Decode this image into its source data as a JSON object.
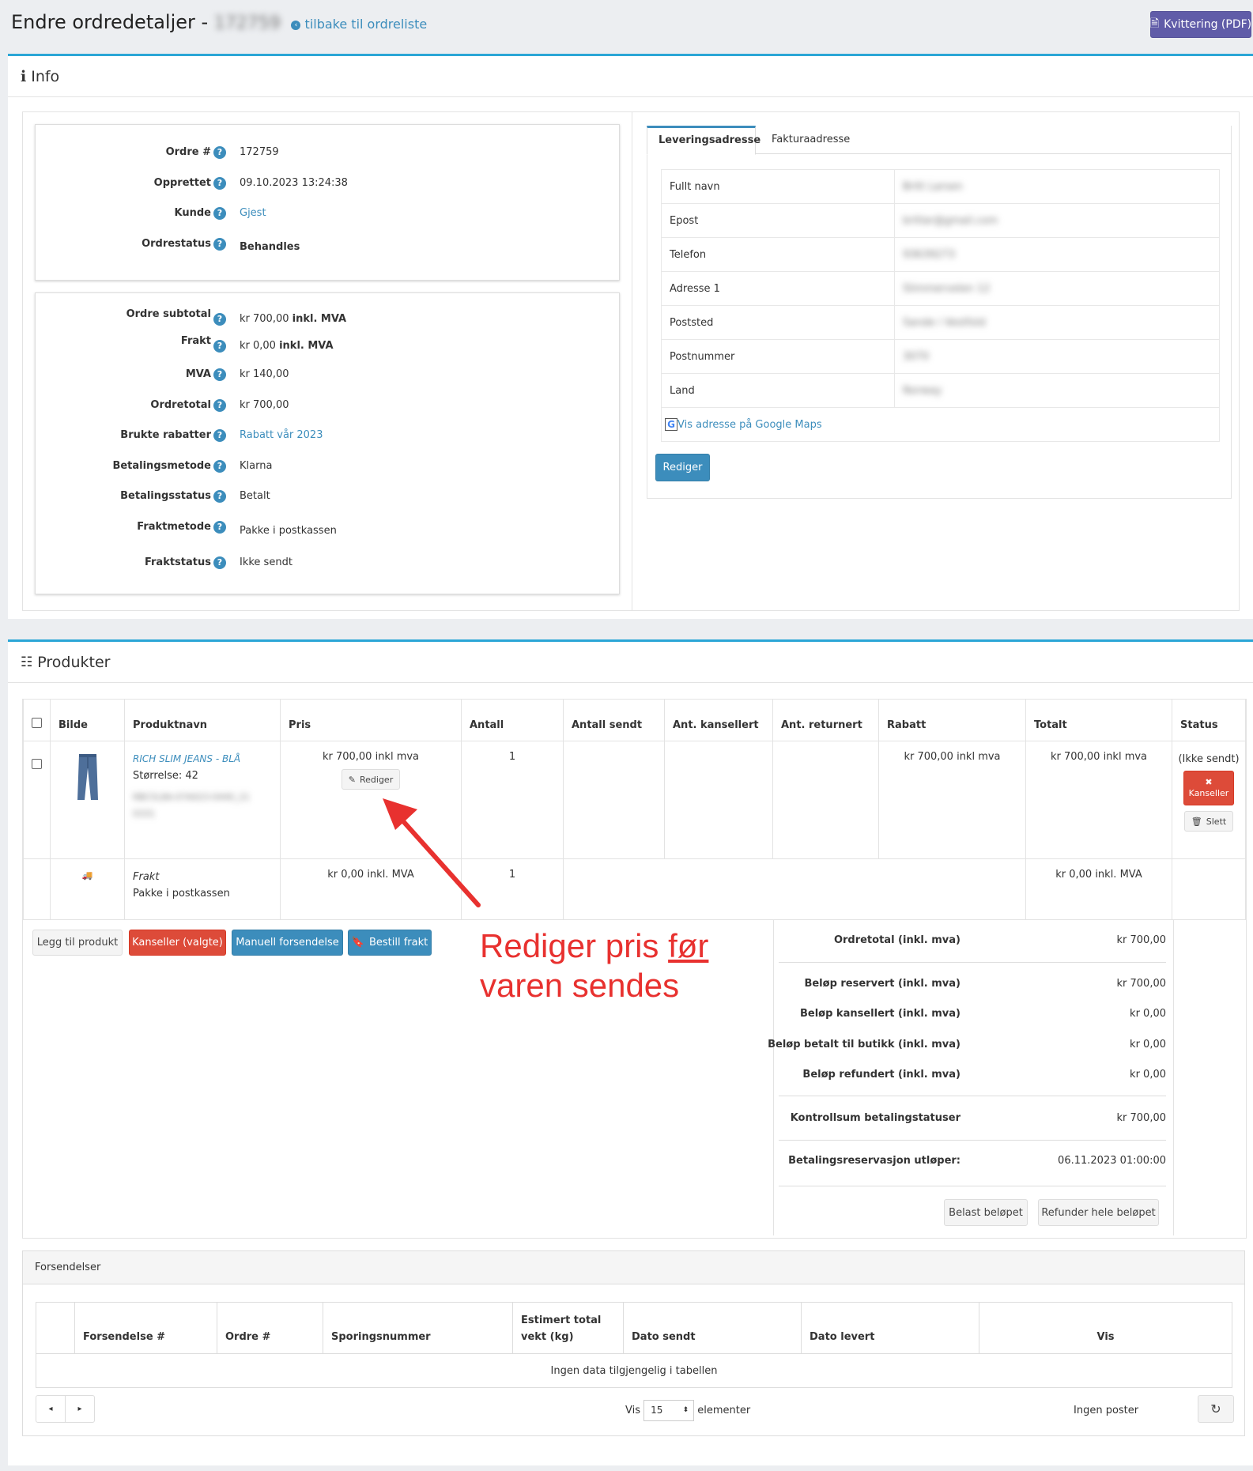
{
  "header": {
    "title": "Endre ordredetaljer -",
    "order_id_blurred": "172759",
    "back_link": "tilbake til ordreliste",
    "receipt_button": "Kvittering (PDF)"
  },
  "info": {
    "section_title": "Info",
    "order_card": [
      {
        "label": "Ordre #",
        "value": "172759"
      },
      {
        "label": "Opprettet",
        "value": "09.10.2023 13:24:38"
      },
      {
        "label": "Kunde",
        "value": "Gjest"
      },
      {
        "label": "Ordrestatus",
        "value": "Behandles"
      }
    ],
    "totals_card": [
      {
        "label": "Ordre subtotal",
        "value": "kr 700,00",
        "suffix": "inkl. MVA"
      },
      {
        "label": "Frakt",
        "value": "kr 0,00",
        "suffix": "inkl. MVA"
      },
      {
        "label": "MVA",
        "value": "kr 140,00"
      },
      {
        "label": "Ordretotal",
        "value": "kr 700,00"
      },
      {
        "label": "Brukte rabatter",
        "value": "Rabatt vår 2023"
      },
      {
        "label": "Betalingsmetode",
        "value": "Klarna"
      },
      {
        "label": "Betalingsstatus",
        "value": "Betalt"
      },
      {
        "label": "Fraktmetode",
        "value": "Pakke i postkassen"
      },
      {
        "label": "Fraktstatus",
        "value": "Ikke sendt"
      }
    ],
    "tabs": [
      "Leveringsadresse",
      "Fakturaadresse"
    ],
    "address_rows": [
      {
        "label": "Fullt navn",
        "value": "Britt Larsen"
      },
      {
        "label": "Epost",
        "value": "britlar@gmail.com"
      },
      {
        "label": "Telefon",
        "value": "93639273"
      },
      {
        "label": "Adresse 1",
        "value": "Slimmervelen 12"
      },
      {
        "label": "Poststed",
        "value": "Sande i Vestfold"
      },
      {
        "label": "Postnummer",
        "value": "3070"
      },
      {
        "label": "Land",
        "value": "Norway"
      }
    ],
    "maps_link": "Vis adresse på Google Maps",
    "edit_button": "Rediger"
  },
  "products": {
    "section_title": "Produkter",
    "columns": [
      "Bilde",
      "Produktnavn",
      "Pris",
      "Antall",
      "Antall sendt",
      "Ant. kansellert",
      "Ant. returnert",
      "Rabatt",
      "Totalt",
      "Status"
    ],
    "item": {
      "name": "RICH SLIM JEANS - BLÅ",
      "size": "Størrelse: 42",
      "sku": "RBC5L8A-07A023-0440_21 0331",
      "price": "kr 700,00 inkl mva",
      "edit_label": "Rediger",
      "qty": "1",
      "discount": "kr 700,00 inkl mva",
      "total": "kr 700,00 inkl mva",
      "status": "(Ikke sendt)",
      "cancel_label": "Kanseller",
      "delete_label": "Slett"
    },
    "shipping": {
      "name": "Frakt",
      "method": "Pakke i postkassen",
      "price": "kr 0,00 inkl. MVA",
      "qty": "1",
      "total": "kr 0,00 inkl. MVA"
    },
    "actions": {
      "add": "Legg til produkt",
      "cancel_selected": "Kanseller (valgte)",
      "manual_ship": "Manuell forsendelse",
      "order_ship": "Bestill frakt"
    },
    "summary": {
      "order_total_label": "Ordretotal (inkl. mva)",
      "order_total": "kr 700,00",
      "reserved_label": "Beløp reservert (inkl. mva)",
      "reserved": "kr 700,00",
      "cancelled_label": "Beløp kansellert (inkl. mva)",
      "cancelled": "kr 0,00",
      "paid_label": "Beløp betalt til butikk (inkl. mva)",
      "paid": "kr 0,00",
      "refunded_label": "Beløp refundert (inkl. mva)",
      "refunded": "kr 0,00",
      "checksum_label": "Kontrollsum betalingstatuser",
      "checksum": "kr 700,00",
      "expires_label": "Betalingsreservasjon utløper:",
      "expires": "06.11.2023 01:00:00",
      "charge_button": "Belast beløpet",
      "refund_button": "Refunder hele beløpet"
    }
  },
  "annotation": {
    "line1_pre": "Rediger pris ",
    "line1_emph": "før",
    "line2": "varen sendes"
  },
  "shipments": {
    "title": "Forsendelser",
    "columns": [
      "Forsendelse #",
      "Ordre #",
      "Sporingsnummer",
      "Estimert total vekt (kg)",
      "Dato sendt",
      "Dato levert",
      "Vis"
    ],
    "empty": "Ingen data tilgjengelig i tabellen",
    "show_label": "Vis",
    "page_size": "15",
    "elements_label": "elementer",
    "no_records": "Ingen poster"
  },
  "colors": {
    "accent": "#3c8dbc",
    "danger": "#dd4b39",
    "purple": "#605ca8",
    "annotation": "#e8312f",
    "section_border": "#2ba6d6"
  }
}
